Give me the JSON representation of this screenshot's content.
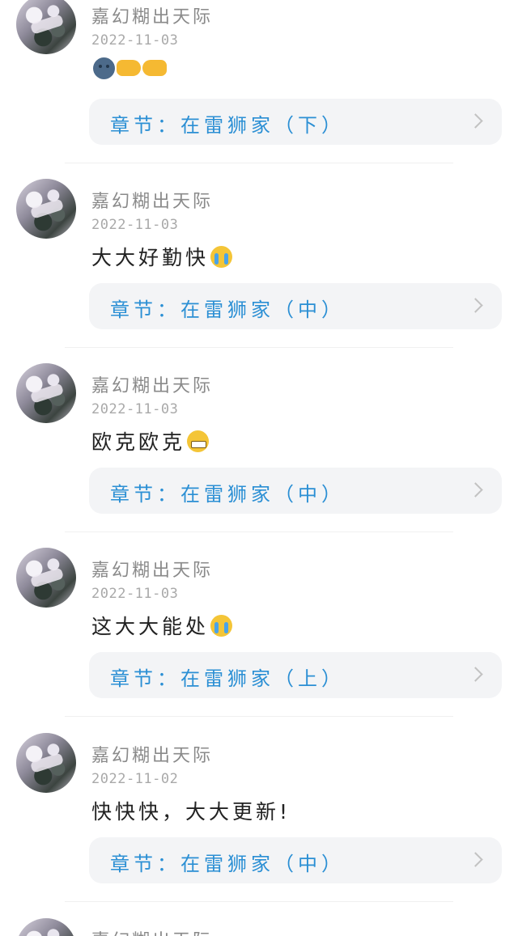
{
  "comments": [
    {
      "username": "嘉幻糊出天际",
      "date": "2022-11-03",
      "text": "",
      "emojis": [
        "moon-face-icon",
        "point-right-icon",
        "point-left-icon"
      ],
      "chapter": "章节：在雷狮家（下）"
    },
    {
      "username": "嘉幻糊出天际",
      "date": "2022-11-03",
      "text": "大大好勤快",
      "emojis": [
        "crying-face-icon"
      ],
      "chapter": "章节：在雷狮家（中）"
    },
    {
      "username": "嘉幻糊出天际",
      "date": "2022-11-03",
      "text": "欧克欧克",
      "emojis": [
        "grin-face-icon"
      ],
      "chapter": "章节：在雷狮家（中）"
    },
    {
      "username": "嘉幻糊出天际",
      "date": "2022-11-03",
      "text": "这大大能处",
      "emojis": [
        "crying-face-icon"
      ],
      "chapter": "章节：在雷狮家（上）"
    },
    {
      "username": "嘉幻糊出天际",
      "date": "2022-11-02",
      "text": "快快快，大大更新!",
      "emojis": [],
      "chapter": "章节：在雷狮家（中）"
    },
    {
      "username": "嘉幻糊出天际",
      "date": "",
      "text": "",
      "emojis": [],
      "chapter": ""
    }
  ]
}
